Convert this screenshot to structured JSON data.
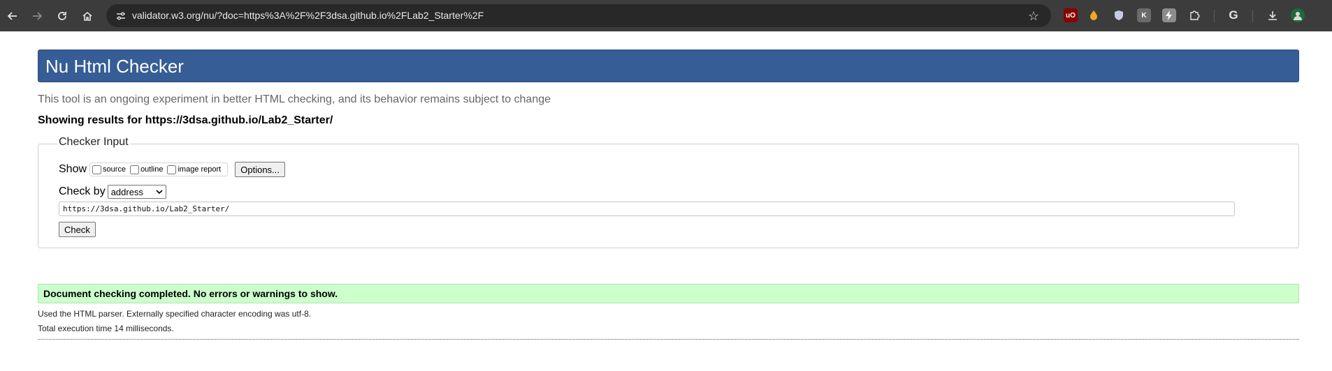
{
  "browser": {
    "url": "validator.w3.org/nu/?doc=https%3A%2F%2F3dsa.github.io%2FLab2_Starter%2F",
    "icons": {
      "back": "back-arrow-icon",
      "forward": "forward-arrow-icon",
      "reload": "reload-icon",
      "home": "home-icon",
      "site_info": "tune-icon",
      "bookmark": "star-icon",
      "extensions": [
        "ublock-icon",
        "extension-orange-icon",
        "shield-icon",
        "extension-k-icon",
        "extension-bolt-icon",
        "puzzle-icon"
      ],
      "google": "google-icon",
      "download": "download-icon",
      "profile": "avatar-icon"
    },
    "extension_labels": {
      "ublock": "uO",
      "k": "K"
    }
  },
  "page": {
    "title": "Nu Html Checker",
    "intro": "This tool is an ongoing experiment in better HTML checking, and its behavior remains subject to change",
    "results_for": "Showing results for https://3dsa.github.io/Lab2_Starter/",
    "checker_input": {
      "legend": "Checker Input",
      "show_label": "Show",
      "show_options": [
        {
          "label": "source",
          "checked": false
        },
        {
          "label": "outline",
          "checked": false
        },
        {
          "label": "image report",
          "checked": false
        }
      ],
      "options_button": "Options...",
      "check_by_label": "Check by",
      "check_by_value": "address",
      "address_value": "https://3dsa.github.io/Lab2_Starter/",
      "check_button": "Check"
    },
    "result_message": "Document checking completed. No errors or warnings to show.",
    "parser_info": "Used the HTML parser. Externally specified character encoding was utf-8.",
    "execution_time": "Total execution time 14 milliseconds."
  },
  "colors": {
    "header_bg": "#365d95",
    "success_bg": "#ccffcc",
    "toolbar_bg": "#3c3c3c"
  }
}
